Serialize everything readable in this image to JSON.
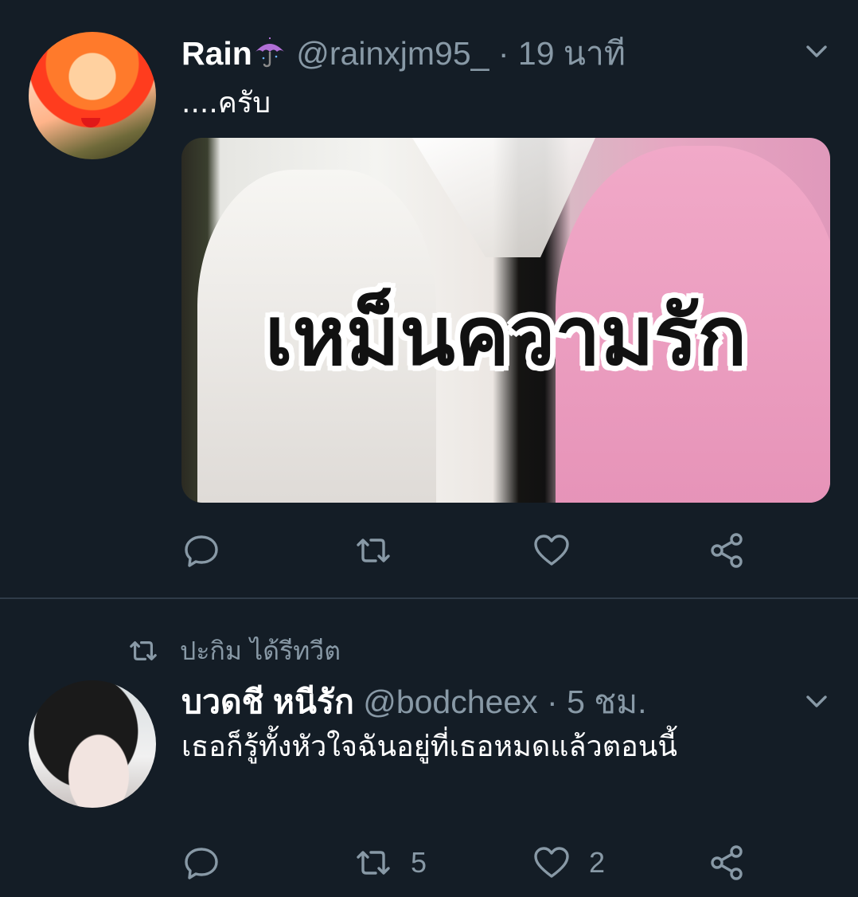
{
  "tweets": [
    {
      "name": "Rain",
      "name_emoji": "umbrella-icon",
      "handle": "@rainxjm95_",
      "separator": "·",
      "time": "19 นาที",
      "text": "....ครับ",
      "media": {
        "overlay_text": "เหม็นความรัก"
      },
      "actions": {
        "retweet_count": "",
        "like_count": ""
      }
    },
    {
      "retweeted_by": "ปะกิม ได้รีทวีต",
      "name": "บวดชี หนีรัก",
      "handle": "@bodcheex",
      "separator": "·",
      "time": "5 ชม.",
      "text": "เธอก็รู้ทั้งหัวใจฉันอยู่ที่เธอหมดแล้วตอนนี้",
      "actions": {
        "retweet_count": "5",
        "like_count": "2"
      }
    }
  ],
  "colors": {
    "background": "#141d26",
    "secondary_text": "#8899a6",
    "divider": "#2f3b48",
    "umbrella": "#b06fd6"
  },
  "icons": [
    "reply-icon",
    "retweet-icon",
    "like-icon",
    "share-icon",
    "chevron-down-icon",
    "umbrella-icon"
  ]
}
